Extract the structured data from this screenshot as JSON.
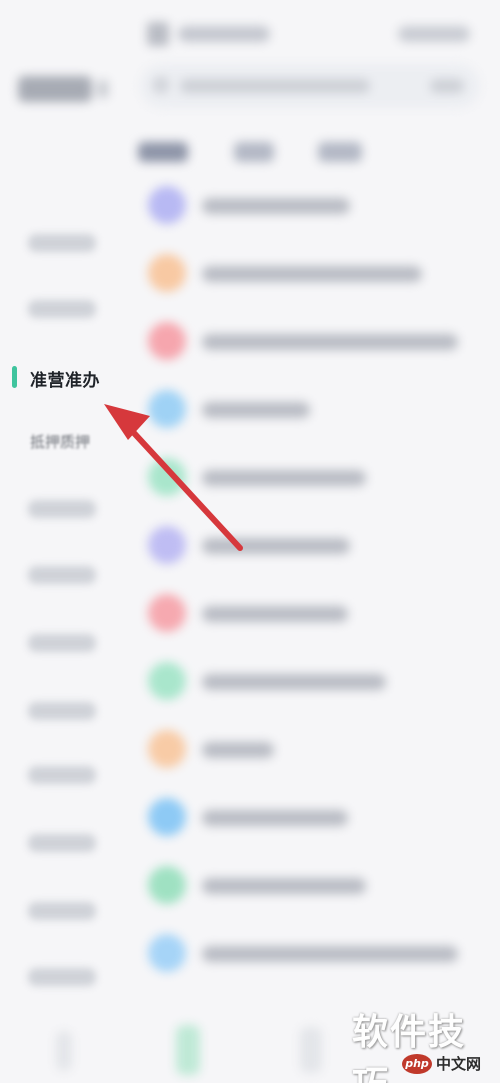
{
  "sidebar": {
    "active_item": "准营准办",
    "next_item": "抵押质押"
  },
  "list_rows": [
    {
      "color": "#b8b9f3"
    },
    {
      "color": "#f8c9a3"
    },
    {
      "color": "#f6a6ae"
    },
    {
      "color": "#9fd2f5"
    },
    {
      "color": "#a9e6cc"
    },
    {
      "color": "#bfbdf3"
    },
    {
      "color": "#f6a9b0"
    },
    {
      "color": "#a9e6cc"
    },
    {
      "color": "#f8cba6"
    },
    {
      "color": "#8ecaf5"
    },
    {
      "color": "#9fe1c2"
    },
    {
      "color": "#a6d4f7"
    }
  ],
  "accent_color": "#3fc49e",
  "annotation_arrow_color": "#d6383c",
  "watermark": {
    "main": "软件技巧",
    "logo": "php",
    "site": "中文网"
  }
}
